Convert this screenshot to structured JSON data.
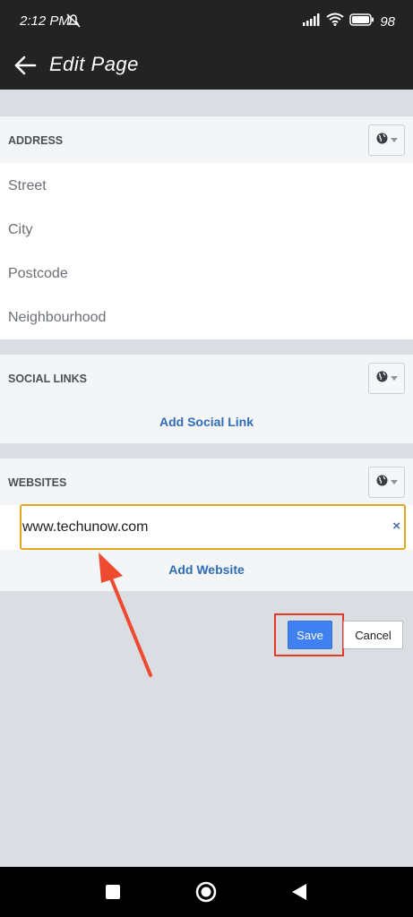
{
  "status_bar": {
    "time": "2:12 PM",
    "battery": "98",
    "icons": [
      "mute-icon",
      "signal-icon",
      "wifi-icon",
      "battery-icon"
    ]
  },
  "app_bar": {
    "title": "Edit Page",
    "back_icon": "arrow-left-icon"
  },
  "address": {
    "title": "ADDRESS",
    "privacy_icon": "globe-icon",
    "fields": [
      "Street",
      "City",
      "Postcode",
      "Neighbourhood"
    ]
  },
  "social_links": {
    "title": "SOCIAL LINKS",
    "privacy_icon": "globe-icon",
    "add_label": "Add Social Link"
  },
  "websites": {
    "title": "WEBSITES",
    "privacy_icon": "globe-icon",
    "value": "www.techunow.com",
    "clear_label": "×",
    "add_label": "Add Website"
  },
  "actions": {
    "save_label": "Save",
    "cancel_label": "Cancel"
  },
  "colors": {
    "accent": "#4080f1",
    "link": "#2f6db4",
    "highlight": "#e5392a",
    "focus_border": "#e0a81d"
  }
}
